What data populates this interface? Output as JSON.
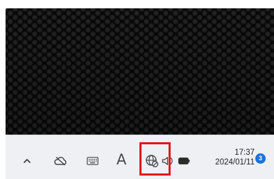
{
  "taskbar": {
    "icons": {
      "show_hidden": "chevron-up-icon",
      "onedrive": "onedrive-cloud-icon",
      "touch_keyboard": "keyboard-icon",
      "network": "globe-no-connection-icon",
      "volume": "speaker-icon",
      "battery": "battery-icon"
    },
    "ime_label": "A",
    "clock": {
      "time": "17:37",
      "date": "2024/01/11"
    },
    "notification_count": "3"
  },
  "colors": {
    "highlight_border": "#e0141b",
    "badge": "#1a73d9",
    "taskbar_bg": "#eef0f3"
  }
}
